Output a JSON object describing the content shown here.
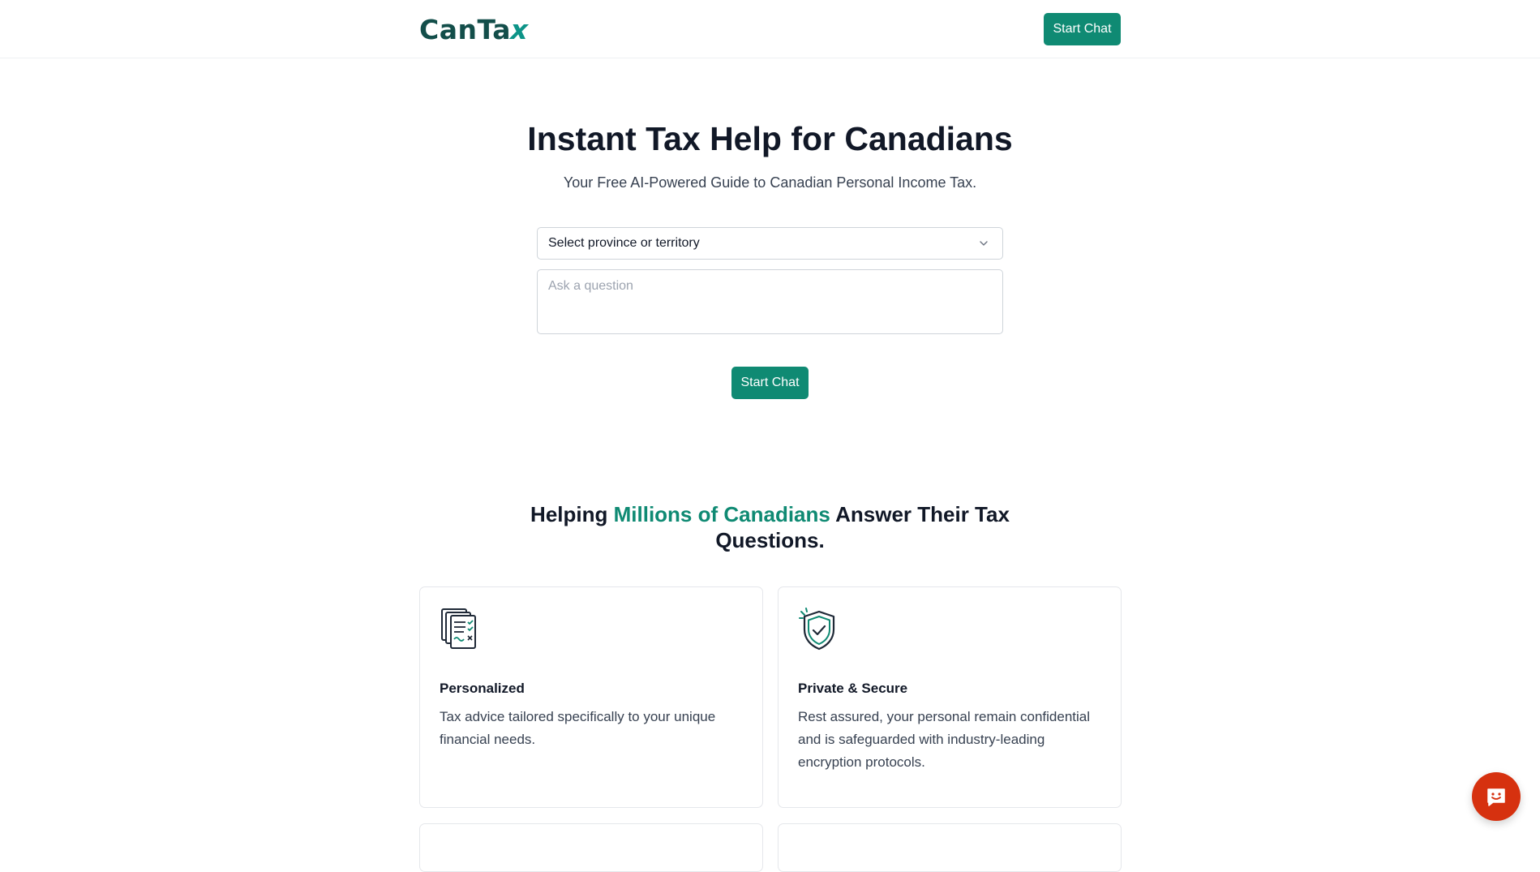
{
  "header": {
    "logo_main": "CanTa",
    "logo_accent": "x",
    "cta_label": "Start Chat"
  },
  "hero": {
    "title": "Instant Tax Help for Canadians",
    "subtitle": "Your Free AI-Powered Guide to Canadian Personal Income Tax.",
    "province_select": {
      "selected": "Select province or territory"
    },
    "question_input": {
      "placeholder": "Ask a question",
      "value": ""
    },
    "submit_label": "Start Chat"
  },
  "features": {
    "heading_before": "Helping ",
    "heading_accent": "Millions of Canadians",
    "heading_after": " Answer Their Tax Questions.",
    "cards": [
      {
        "icon": "document-checklist-icon",
        "title": "Personalized",
        "text": "Tax advice tailored specifically to your unique financial needs."
      },
      {
        "icon": "shield-check-icon",
        "title": "Private & Secure",
        "text": "Rest assured, your personal remain confidential and is safeguarded with industry-leading encryption protocols."
      }
    ]
  },
  "chat_widget": {
    "icon": "chat-smile-icon"
  },
  "colors": {
    "brand": "#0f8a73",
    "logo_dark": "#134e4a",
    "chat_fab": "#d6310f"
  }
}
